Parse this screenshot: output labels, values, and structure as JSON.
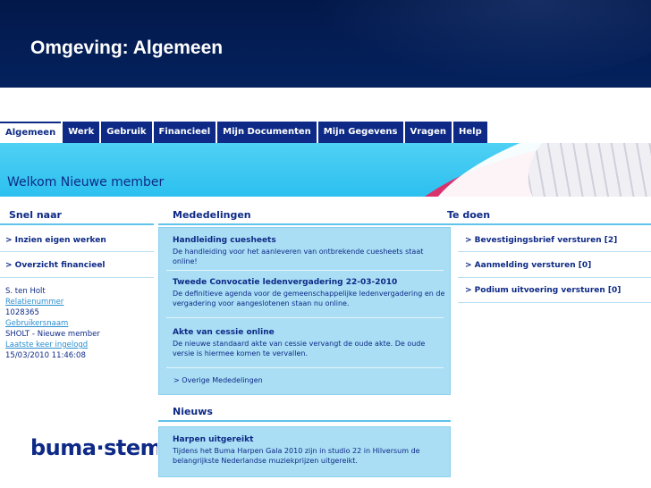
{
  "slide": {
    "title": "Omgeving: Algemeen"
  },
  "tabs": [
    {
      "label": "Algemeen",
      "active": true
    },
    {
      "label": "Werk"
    },
    {
      "label": "Gebruik"
    },
    {
      "label": "Financieel"
    },
    {
      "label": "Mijn Documenten"
    },
    {
      "label": "Mijn Gegevens"
    },
    {
      "label": "Vragen"
    },
    {
      "label": "Help"
    }
  ],
  "welcome": "Welkom Nieuwe member",
  "columns": {
    "left": "Snel naar",
    "middle": "Mededelingen",
    "right": "Te doen"
  },
  "quick_links": [
    "> Inzien eigen werken",
    "> Overzicht financieel"
  ],
  "user": {
    "name": "S. ten Holt",
    "relation_label": "Relatienummer",
    "relation_number": "1028365",
    "username_label": "Gebruikersnaam",
    "username": "SHOLT - Nieuwe member",
    "last_login_label": "Laatste keer ingelogd",
    "last_login": "15/03/2010 11:46:08"
  },
  "announcements": [
    {
      "title": "Handleiding cuesheets",
      "text_lines": [
        "De handleiding voor het aanleveren van ontbrekende cuesheets staat",
        "online!"
      ]
    },
    {
      "title": "Tweede Convocatie ledenvergadering 22-03-2010",
      "text_lines": [
        "De definitieve agenda voor de gemeenschappelijke ledenvergadering en de",
        "vergadering voor aangeslotenen staan nu online."
      ]
    },
    {
      "title": "Akte van cessie online",
      "text_lines": [
        "De nieuwe standaard akte van cessie vervangt de oude akte. De oude",
        "versie is hiermee komen te vervallen."
      ]
    }
  ],
  "announcements_more": "> Overige Mededelingen",
  "news": {
    "heading": "Nieuws",
    "items": [
      {
        "title": "Harpen uitgereikt",
        "text_lines": [
          "Tijdens het Buma Harpen Gala 2010 zijn in studio 22 in Hilversum de",
          "belangrijkste Nederlandse muziekprijzen uitgereikt."
        ]
      }
    ]
  },
  "todo": [
    "> Bevestigingsbrief versturen [2]",
    "> Aanmelding versturen [0]",
    "> Podium uitvoering versturen [0]"
  ],
  "logo_text": "buma·stemra",
  "colors": {
    "header_bg": "#05225e",
    "tab_bg": "#0e2a86",
    "banner_cyan": "#2cc0ef",
    "panel_bg": "#a9def5",
    "accent_pink": "#d8336d"
  }
}
